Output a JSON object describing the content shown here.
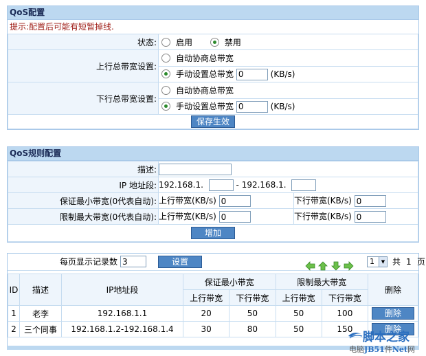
{
  "qos": {
    "title": "QoS配置",
    "tip": "提示:配置后可能有短暂掉线.",
    "status_label": "状态:",
    "enable_label": "启用",
    "disable_label": "禁用",
    "up_label": "上行总带宽设置:",
    "down_label": "下行总带宽设置:",
    "auto_label": "自动协商总带宽",
    "manual_label": "手动设置总带宽",
    "unit": "(KB/s)",
    "up_value": "0",
    "down_value": "0",
    "save_button": "保存生效"
  },
  "rules": {
    "title": "QoS规则配置",
    "desc_label": "描述:",
    "ip_label": "IP 地址段:",
    "ip_prefix_start": "192.168.1.",
    "ip_sep": "- 192.168.1.",
    "min_label": "保证最小带宽(0代表自动):",
    "max_label": "限制最大带宽(0代表自动):",
    "up_kb_label": "上行带宽(KB/s)",
    "down_kb_label": "下行带宽(KB/s)",
    "min_up": "0",
    "min_down": "0",
    "max_up": "0",
    "max_down": "0",
    "add_button": "增加"
  },
  "list": {
    "per_page_label": "每页显示记录数",
    "per_page_value": "3",
    "set_button": "设置",
    "page_value": "1",
    "total_prefix": "共",
    "total_pages": "1",
    "total_suffix": "页",
    "headers": {
      "id": "ID",
      "desc": "描述",
      "ip": "IP地址段",
      "min": "保证最小带宽",
      "max": "限制最大带宽",
      "delete": "删除",
      "up": "上行带宽",
      "down": "下行带宽"
    },
    "rows": [
      {
        "id": "1",
        "desc": "老李",
        "ip": "192.168.1.1",
        "min_up": "20",
        "min_down": "50",
        "max_up": "50",
        "max_down": "100",
        "delete": "删除"
      },
      {
        "id": "2",
        "desc": "三个同事",
        "ip": "192.168.1.2-192.168.1.4",
        "min_up": "30",
        "min_down": "80",
        "max_up": "50",
        "max_down": "150",
        "delete": "删除"
      }
    ]
  },
  "watermark": {
    "line1": "脚本之家",
    "line2_a": "电脑",
    "line2_b": "JB51",
    "line2_c": "件",
    "line2_d": "Net",
    "line2_e": "网"
  },
  "colors": {
    "title_bg": "#bcd8f0",
    "label_bg": "#eef5fc",
    "button_bg": "#4e86c4",
    "tip_text": "#a0201a"
  }
}
